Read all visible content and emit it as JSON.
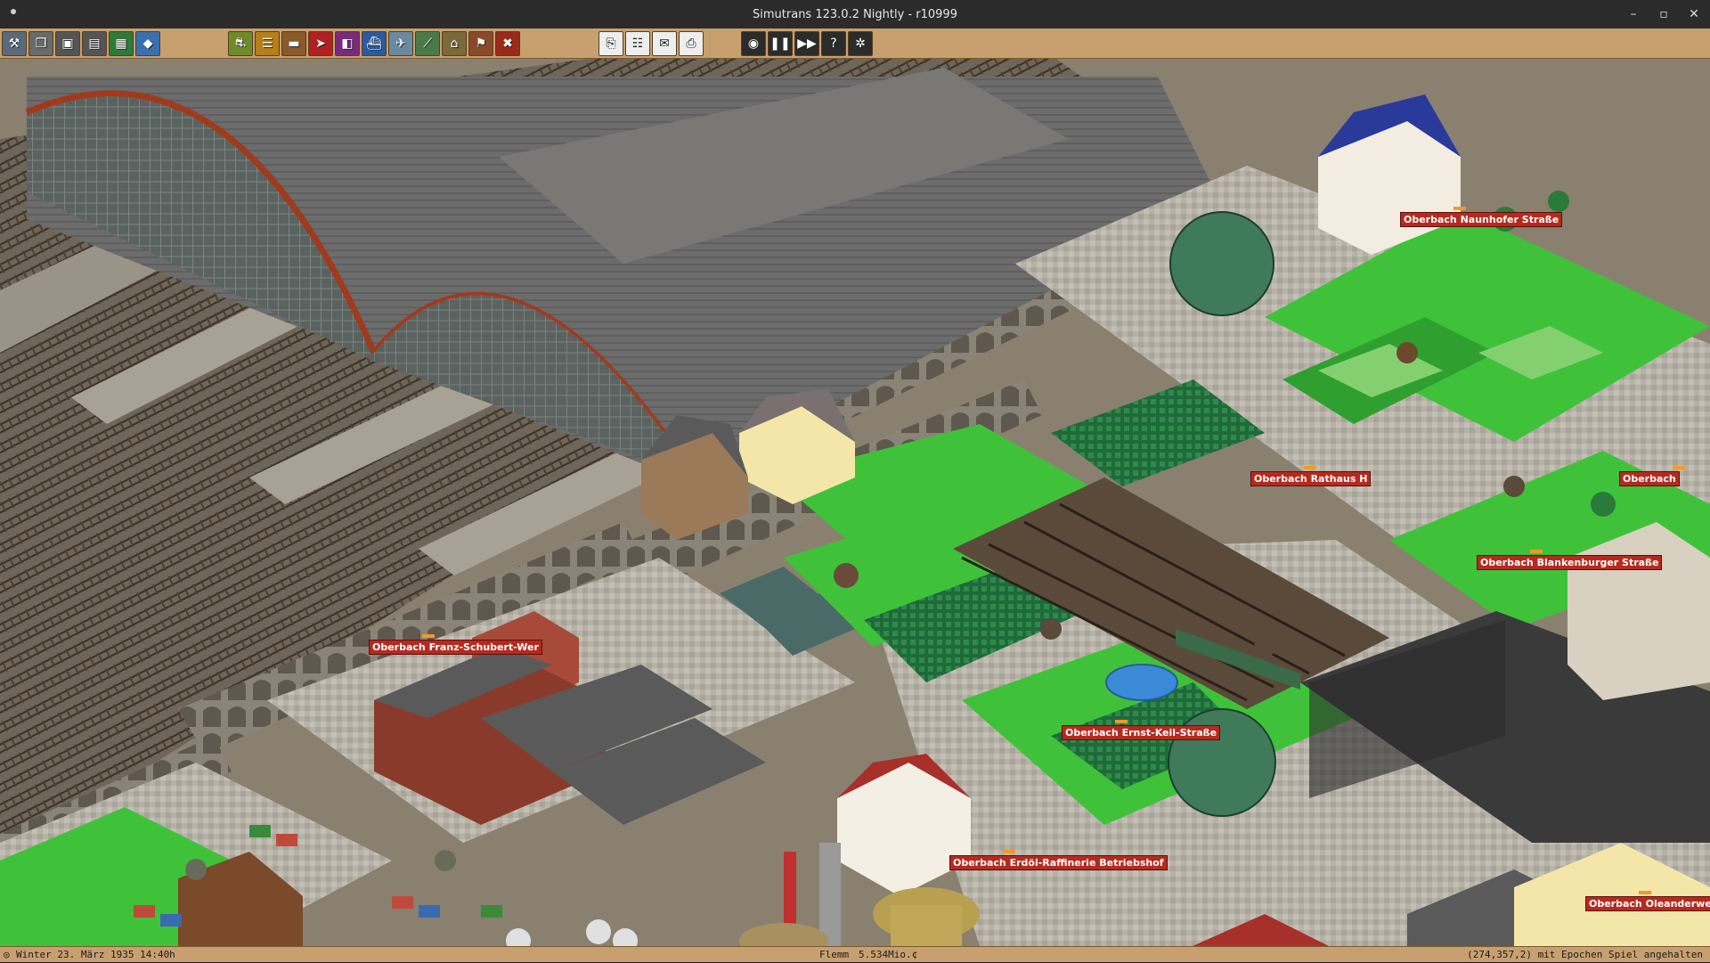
{
  "window": {
    "title": "Simutrans 123.0.2 Nightly - r10999",
    "minimize_icon": "–",
    "maximize_icon": "▫",
    "close_icon": "✕"
  },
  "toolbar": {
    "groups": [
      {
        "name": "main",
        "tools": [
          {
            "id": "construction-tools",
            "glyph": "⚒",
            "color": "#5a6a7a"
          },
          {
            "id": "window-list",
            "glyph": "❐",
            "color": "#6a6a6a"
          },
          {
            "id": "save-game",
            "glyph": "▣",
            "color": "#555"
          },
          {
            "id": "load-game",
            "glyph": "▤",
            "color": "#555"
          },
          {
            "id": "map-overview",
            "glyph": "▦",
            "color": "#2f7a3a"
          },
          {
            "id": "terrain-tools",
            "glyph": "◆",
            "color": "#3a6fb0"
          }
        ]
      },
      {
        "name": "transport",
        "tools": [
          {
            "id": "road-tools",
            "glyph": "⛐",
            "color": "#6f8a2a"
          },
          {
            "id": "rail-tools",
            "glyph": "☰",
            "color": "#b57f1a"
          },
          {
            "id": "monorail-tools",
            "glyph": "▬",
            "color": "#8a5a2a"
          },
          {
            "id": "maglev-tools",
            "glyph": "➤",
            "color": "#b02020"
          },
          {
            "id": "tram-tools",
            "glyph": "◧",
            "color": "#7a2a7a"
          },
          {
            "id": "ship-tools",
            "glyph": "⛴",
            "color": "#2a5aa0"
          },
          {
            "id": "air-tools",
            "glyph": "✈",
            "color": "#6a8aa0"
          },
          {
            "id": "narrowgauge-tools",
            "glyph": "⟋",
            "color": "#4a7a4a"
          },
          {
            "id": "depot-tools",
            "glyph": "⌂",
            "color": "#7a6a3a"
          },
          {
            "id": "special-tools",
            "glyph": "⚑",
            "color": "#8a4a2a"
          },
          {
            "id": "remove-tools",
            "glyph": "✖",
            "color": "#9a2a1a"
          }
        ]
      },
      {
        "name": "info",
        "tools": [
          {
            "id": "finance-dialog",
            "glyph": "⎘",
            "color": "#eeeeee"
          },
          {
            "id": "list-dialog",
            "glyph": "☷",
            "color": "#eeeeee"
          },
          {
            "id": "mail-dialog",
            "glyph": "✉",
            "color": "#eeeeee"
          },
          {
            "id": "print-dialog",
            "glyph": "⎙",
            "color": "#eeeeee"
          }
        ]
      },
      {
        "name": "control",
        "tools": [
          {
            "id": "screenshot",
            "glyph": "◉",
            "color": "#2b2b2b"
          },
          {
            "id": "pause",
            "glyph": "❚❚",
            "color": "#2b2b2b"
          },
          {
            "id": "fast-forward",
            "glyph": "▶▶",
            "color": "#2b2b2b"
          },
          {
            "id": "help",
            "glyph": "?",
            "color": "#2b2b2b"
          },
          {
            "id": "settings",
            "glyph": "✲",
            "color": "#2b2b2b"
          }
        ]
      }
    ]
  },
  "city_labels": [
    {
      "text": "Oberbach Naunhofer Straße"
    },
    {
      "text": "Oberbach Rathaus H"
    },
    {
      "text": "Oberbach"
    },
    {
      "text": "Oberbach Blankenburger Straße"
    },
    {
      "text": "Oberbach Franz-Schubert-Wer"
    },
    {
      "text": "Oberbach Ernst-Keil-Straße"
    },
    {
      "text": "Oberbach Erdöl-Raffinerie Betriebshof"
    },
    {
      "text": "Oberbach Oleanderweg"
    }
  ],
  "status": {
    "date": "Winter 23. März 1935 14:40h",
    "player": "Flemm",
    "money": "5.534Mio.¢",
    "coords_and_state": "(274,357,2) mit Epochen Spiel angehalten"
  },
  "colors": {
    "toolbar_bg": "#c8a070",
    "label_bg": "#b52a1f",
    "grass": "#3fc23a",
    "pavement": "#b9b4aa",
    "roof_grey": "#6a6a6a",
    "arch_red": "#a03a1c"
  }
}
